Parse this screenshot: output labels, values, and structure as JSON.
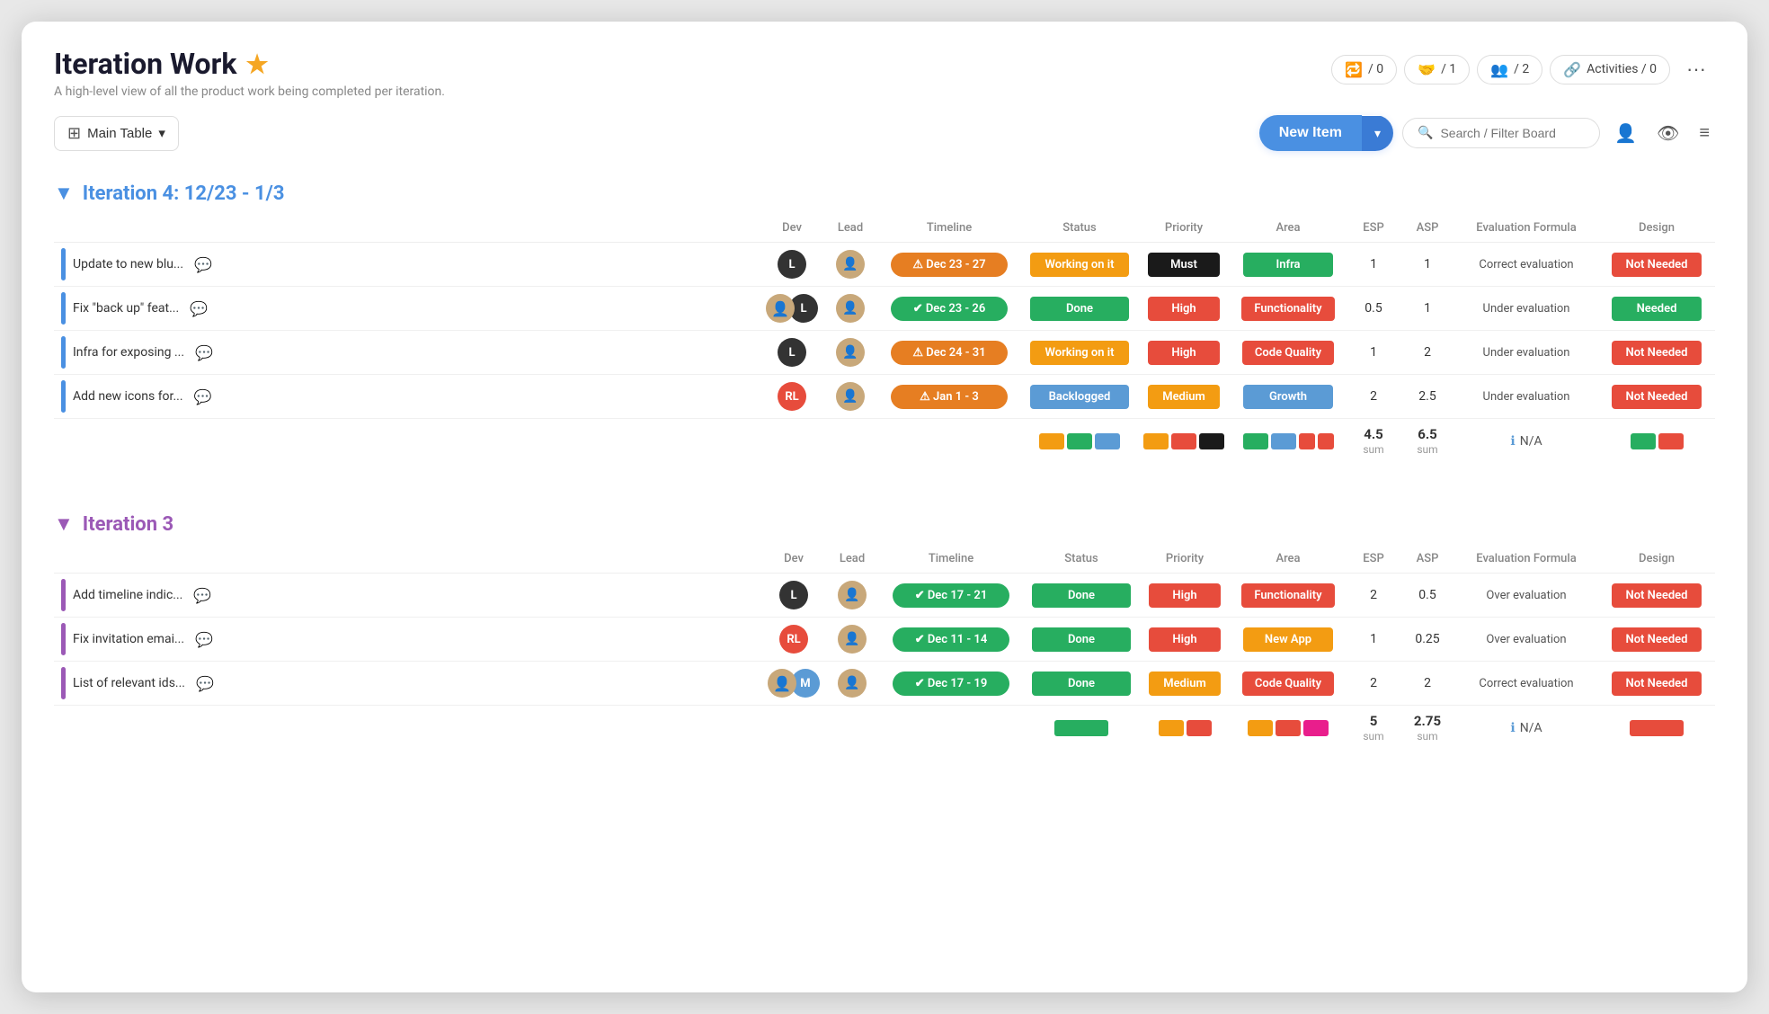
{
  "app": {
    "title": "Iteration Work",
    "subtitle": "A high-level view of all the product work being completed per iteration.",
    "starred": true
  },
  "header_badges": [
    {
      "id": "comments",
      "icon": "💬",
      "value": "/ 0"
    },
    {
      "id": "users2",
      "icon": "👥",
      "value": "/ 1"
    },
    {
      "id": "users3",
      "icon": "👤",
      "value": "/ 2"
    },
    {
      "id": "activities",
      "icon": "🔗",
      "value": "Activities / 0"
    }
  ],
  "toolbar": {
    "table_label": "Main Table",
    "new_item_label": "New Item",
    "dropdown_icon": "▼",
    "search_placeholder": "Search / Filter Board"
  },
  "iterations": [
    {
      "id": "iter4",
      "title": "Iteration 4: 12/23 - 1/3",
      "color": "blue",
      "columns": [
        "Dev",
        "Lead",
        "Timeline",
        "Status",
        "Priority",
        "Area",
        "ESP",
        "ASP",
        "Evaluation Formula",
        "Design"
      ],
      "rows": [
        {
          "name": "Update to new blu...",
          "bar_color": "blue",
          "dev_avatar": {
            "type": "letter",
            "text": "L",
            "bg": "#333"
          },
          "lead_avatar": {
            "type": "person",
            "emoji": "👤"
          },
          "timeline": "Dec 23 - 27",
          "timeline_type": "warning",
          "status": "Working on it",
          "status_type": "working",
          "priority": "Must",
          "priority_type": "must",
          "area": "Infra",
          "area_type": "infra",
          "esp": 1,
          "asp": 1,
          "eval": "Correct evaluation",
          "design": "Not Needed",
          "design_type": "not-needed"
        },
        {
          "name": "Fix \"back up\" feat...",
          "bar_color": "blue",
          "dev_avatar": {
            "type": "multi",
            "avatars": [
              {
                "text": "L",
                "bg": "#333"
              },
              {
                "emoji": "👤"
              }
            ]
          },
          "lead_avatar": {
            "type": "person",
            "emoji": "👤"
          },
          "timeline": "Dec 23 - 26",
          "timeline_type": "success",
          "status": "Done",
          "status_type": "done",
          "priority": "High",
          "priority_type": "high",
          "area": "Functionality",
          "area_type": "functionality",
          "esp": 0.5,
          "asp": 1,
          "eval": "Under evaluation",
          "design": "Needed",
          "design_type": "needed"
        },
        {
          "name": "Infra for exposing ...",
          "bar_color": "blue",
          "dev_avatar": {
            "type": "letter",
            "text": "L",
            "bg": "#333"
          },
          "lead_avatar": {
            "type": "person",
            "emoji": "👤"
          },
          "timeline": "Dec 24 - 31",
          "timeline_type": "warning",
          "status": "Working on it",
          "status_type": "working",
          "priority": "High",
          "priority_type": "high",
          "area": "Code Quality",
          "area_type": "code",
          "esp": 1,
          "asp": 2,
          "eval": "Under evaluation",
          "design": "Not Needed",
          "design_type": "not-needed"
        },
        {
          "name": "Add new icons for...",
          "bar_color": "blue",
          "dev_avatar": {
            "type": "letter",
            "text": "RL",
            "bg": "#e74c3c"
          },
          "lead_avatar": {
            "type": "person",
            "emoji": "👤"
          },
          "timeline": "Jan 1 - 3",
          "timeline_type": "warning",
          "status": "Backlogged",
          "status_type": "backlogged",
          "priority": "Medium",
          "priority_type": "medium",
          "area": "Growth",
          "area_type": "growth",
          "esp": 2,
          "asp": 2.5,
          "eval": "Under evaluation",
          "design": "Not Needed",
          "design_type": "not-needed"
        }
      ],
      "sum_row": {
        "status_colors": [
          "#f39c12",
          "#27ae60",
          "#5b9bd5"
        ],
        "priority_colors": [
          "#f39c12",
          "#e74c3c",
          "#1a1a1a"
        ],
        "area_colors": [
          "#27ae60",
          "#5b9bd5"
        ],
        "esp_sum": "4.5",
        "asp_sum": "6.5",
        "design_colors": [
          "#27ae60",
          "#e74c3c"
        ]
      }
    },
    {
      "id": "iter3",
      "title": "Iteration 3",
      "color": "purple",
      "columns": [
        "Dev",
        "Lead",
        "Timeline",
        "Status",
        "Priority",
        "Area",
        "ESP",
        "ASP",
        "Evaluation Formula",
        "Design"
      ],
      "rows": [
        {
          "name": "Add timeline indic...",
          "bar_color": "purple",
          "dev_avatar": {
            "type": "letter",
            "text": "L",
            "bg": "#333"
          },
          "lead_avatar": {
            "type": "person",
            "emoji": "👤"
          },
          "timeline": "Dec 17 - 21",
          "timeline_type": "success",
          "status": "Done",
          "status_type": "done",
          "priority": "High",
          "priority_type": "high",
          "area": "Functionality",
          "area_type": "functionality",
          "esp": 2,
          "asp": 0.5,
          "eval": "Over evaluation",
          "design": "Not Needed",
          "design_type": "not-needed"
        },
        {
          "name": "Fix invitation emai...",
          "bar_color": "purple",
          "dev_avatar": {
            "type": "letter",
            "text": "RL",
            "bg": "#e74c3c"
          },
          "lead_avatar": {
            "type": "person",
            "emoji": "👤"
          },
          "timeline": "Dec 11 - 14",
          "timeline_type": "success",
          "status": "Done",
          "status_type": "done",
          "priority": "High",
          "priority_type": "high",
          "area": "New App",
          "area_type": "newapp",
          "esp": 1,
          "asp": 0.25,
          "eval": "Over evaluation",
          "design": "Not Needed",
          "design_type": "not-needed"
        },
        {
          "name": "List of relevant ids...",
          "bar_color": "purple",
          "dev_avatar": {
            "type": "multi2"
          },
          "lead_avatar": {
            "type": "person",
            "emoji": "👤"
          },
          "timeline": "Dec 17 - 19",
          "timeline_type": "success",
          "status": "Done",
          "status_type": "done",
          "priority": "Medium",
          "priority_type": "medium",
          "area": "Code Quality",
          "area_type": "code",
          "esp": 2,
          "asp": 2,
          "eval": "Correct evaluation",
          "design": "Not Needed",
          "design_type": "not-needed"
        }
      ],
      "sum_row": {
        "status_colors": [
          "#27ae60"
        ],
        "priority_colors": [
          "#f39c12",
          "#e74c3c"
        ],
        "area_colors": [
          "#f39c12",
          "#e74c3c",
          "#e74c3c"
        ],
        "esp_sum": "5",
        "asp_sum": "2.75",
        "design_colors": [
          "#e74c3c"
        ]
      }
    }
  ]
}
